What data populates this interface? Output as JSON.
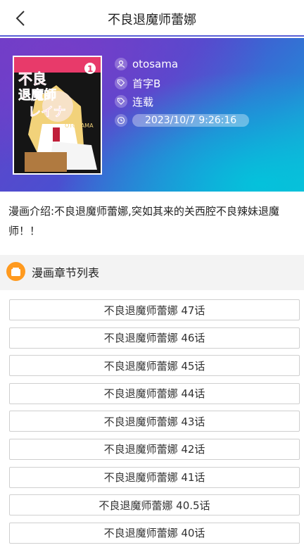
{
  "header": {
    "title": "不良退魔师蕾娜"
  },
  "comic": {
    "cover": {
      "title_line1": "不良",
      "title_line2": "退魔師",
      "title_line3": "レイナ",
      "volume": "1",
      "author_tag": "OTOSAMA"
    },
    "author": "otosama",
    "group": "首字B",
    "status": "连载",
    "updated": "2023/10/7 9:26:16",
    "intro": "漫画介绍:不良退魔师蕾娜,突如其来的关西腔不良辣妹退魔师！！"
  },
  "section": {
    "title": "漫画章节列表"
  },
  "chapters": [
    "不良退魔师蕾娜 47话",
    "不良退魔师蕾娜 46话",
    "不良退魔师蕾娜 45话",
    "不良退魔师蕾娜 44话",
    "不良退魔师蕾娜 43话",
    "不良退魔师蕾娜 42话",
    "不良退魔师蕾娜 41话",
    "不良退魔师蕾娜 40.5话",
    "不良退魔师蕾娜 40话"
  ],
  "colors": {
    "accent_line": "#5a5fd6",
    "section_icon": "#ff9a1f"
  }
}
